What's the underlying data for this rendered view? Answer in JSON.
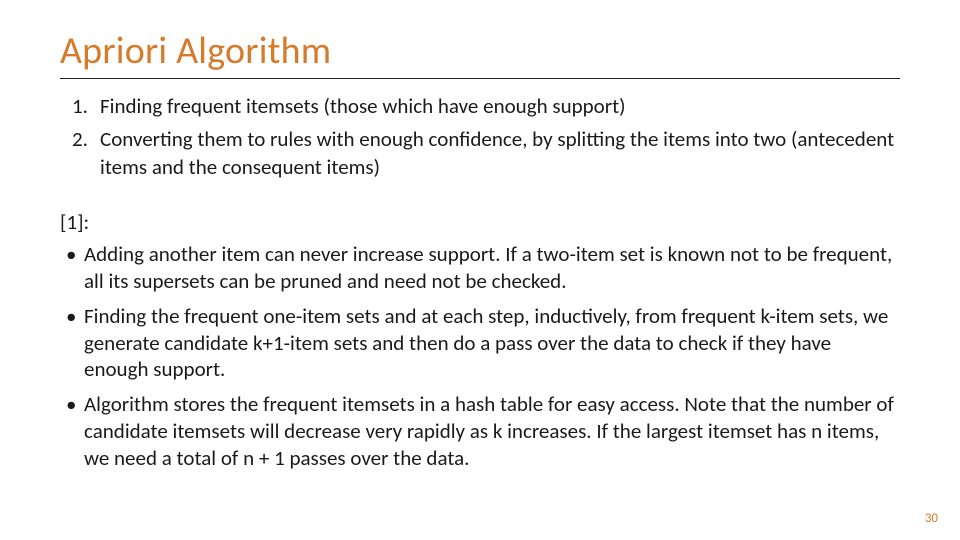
{
  "title": "Apriori Algorithm",
  "numbered": [
    "Finding frequent itemsets (those which have enough support)",
    "Converting them to rules with enough confidence, by splitting the items into two (antecedent items and the consequent items)"
  ],
  "refLabel": "[1]:",
  "bullets": [
    "Adding another item can never increase support. If a two-item set is known not to be frequent, all its supersets can be pruned and need not be checked.",
    "Finding the frequent one-item sets and at each step, inductively, from frequent k-item sets, we generate candidate k+1-item sets and then do a pass over the data to check if they have enough support.",
    "Algorithm stores the frequent itemsets in a hash table for easy access. Note that the number of candidate itemsets will decrease very rapidly as k increases. If the largest itemset has n items, we need a total of n + 1 passes over the data."
  ],
  "pageNumber": "30"
}
